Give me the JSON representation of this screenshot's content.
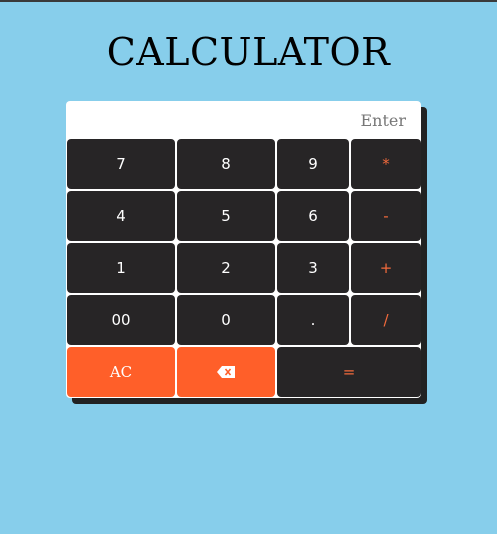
{
  "page": {
    "title": "CALCULATOR"
  },
  "display": {
    "placeholder": "Enter",
    "value": ""
  },
  "keys": {
    "k7": "7",
    "k8": "8",
    "k9": "9",
    "mul": "*",
    "k4": "4",
    "k5": "5",
    "k6": "6",
    "sub": "-",
    "k1": "1",
    "k2": "2",
    "k3": "3",
    "add": "+",
    "k00": "00",
    "k0": "0",
    "dot": ".",
    "div": "/",
    "ac": "AC",
    "eq": "="
  },
  "icons": {
    "backspace": "backspace-icon"
  },
  "colors": {
    "background": "#87ceeb",
    "key": "#272526",
    "accent": "#ff5f29",
    "operator_text": "#f26a3c"
  }
}
